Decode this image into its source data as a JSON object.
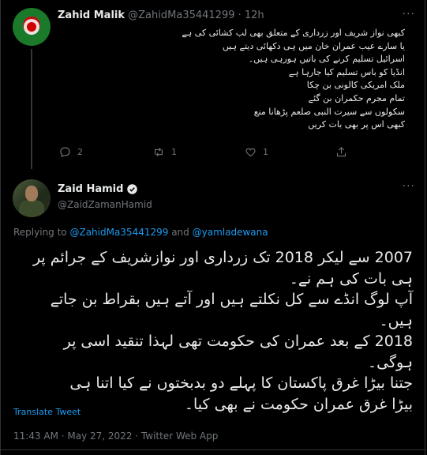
{
  "tweet1": {
    "name": "Zahid Malik",
    "handle_time": "@ZahidMa35441299 · 12h",
    "lines": [
      "کبھی نواز شریف اور زرداری کے متعلق بھی لب کشائی کی ہے",
      "یا سارے عیب عمران خان میں ہی دکھائی دیتے ہیں",
      "اسرائیل تسلیم کرنے کی باتیں ہورہی ہیں۔",
      "انڈیا کو باس تسلیم کیا جارہا ہے",
      "ملک امریکی کالونی بن چکا",
      "تمام مجرم حکمران بن گئے",
      "سکولوں سے سیرت النبی صلعم پڑھانا منع",
      "کبھی اس پر بھی بات کریں"
    ],
    "reply_count": "2",
    "retweet_count": "1",
    "like_count": "1",
    "icons": [
      "reply-icon",
      "retweet-icon",
      "like-icon",
      "share-icon"
    ]
  },
  "tweet2": {
    "name": "Zaid Hamid",
    "handle": "@ZaidZamanHamid",
    "verified": true,
    "replying_prefix": "Replying to ",
    "reply_user1": "@ZahidMa35441299",
    "reply_and": " and ",
    "reply_user2": "@yamladewana",
    "lines": [
      "2007 سے لیکر 2018 تک  زرداری اور نوازشریف کے جرائم پر",
      "ہی بات کی ہم نے۔",
      "آپ لوگ انڈے سے کل نکلتے ہیں اور آتے ہیں بقراط بن جاتے",
      "ہیں۔",
      "2018 کے بعد عمران کی حکومت تھی لہذا تنقید اسی پر",
      "ہوگی۔",
      "جتنا بیڑا غرق پاکستان کا پہلے دو بدبختوں نے کیا اتنا ہی",
      "بیڑا غرق عمران حکومت نے بھی کیا۔"
    ],
    "translate": "Translate Tweet",
    "meta": "11:43 AM · May 27, 2022 · Twitter Web App"
  },
  "colors": {
    "accent": "#1d9bf0",
    "muted": "#71767b",
    "text": "#e7e9ea",
    "bg": "#000000"
  }
}
